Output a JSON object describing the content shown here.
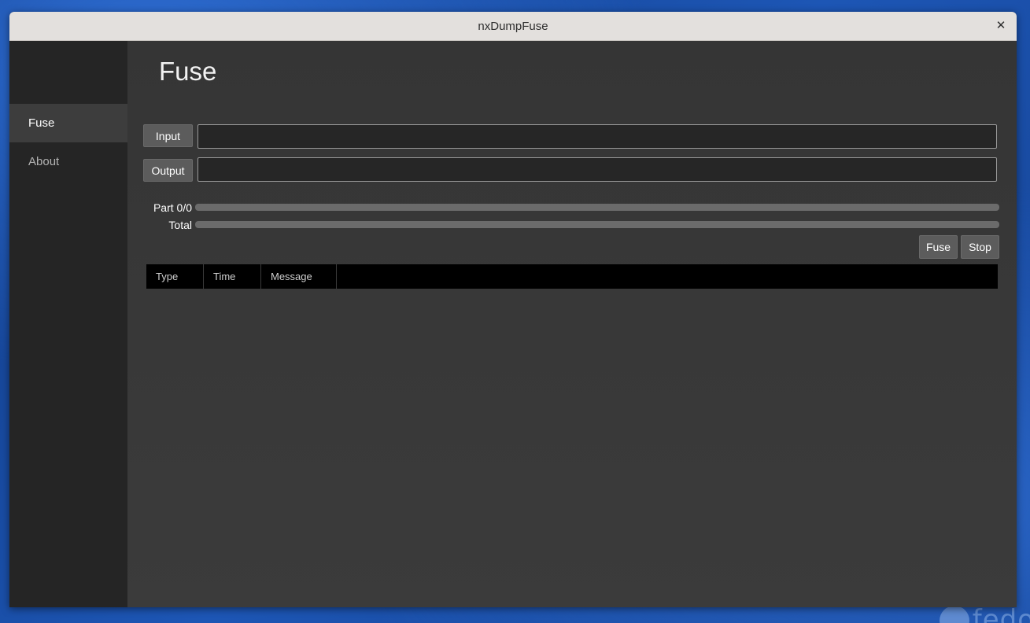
{
  "window": {
    "title": "nxDumpFuse"
  },
  "sidebar": {
    "items": [
      {
        "label": "Fuse",
        "active": true
      },
      {
        "label": "About",
        "active": false
      }
    ]
  },
  "main": {
    "page_title": "Fuse",
    "input": {
      "button_label": "Input",
      "value": ""
    },
    "output": {
      "button_label": "Output",
      "value": ""
    },
    "progress": {
      "part_label": "Part 0/0",
      "part_fraction": 0,
      "total_label": "Total",
      "total_fraction": 0
    },
    "actions": {
      "fuse_label": "Fuse",
      "stop_label": "Stop"
    },
    "log_table": {
      "columns": [
        "Type",
        "Time",
        "Message"
      ],
      "rows": []
    }
  },
  "desktop": {
    "logo_text": "fedo"
  },
  "icons": {
    "close": "close-icon"
  },
  "colors": {
    "progress_fill": "#3a8ee6"
  }
}
